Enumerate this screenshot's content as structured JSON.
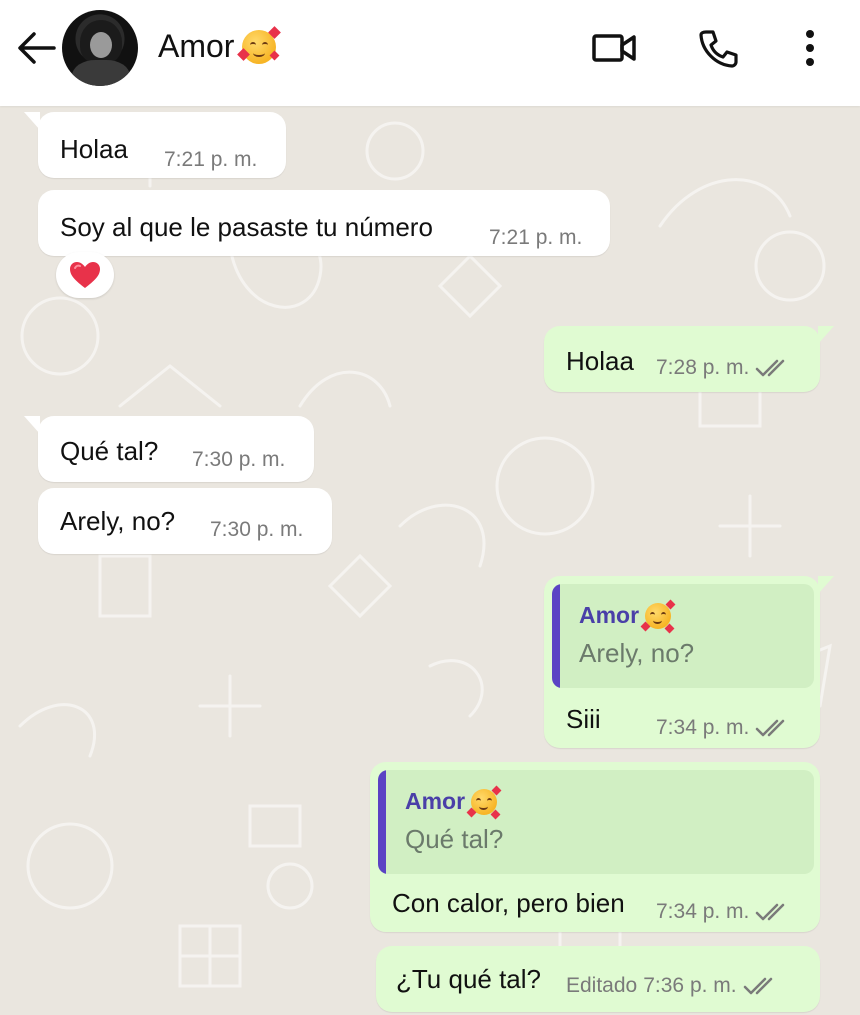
{
  "header": {
    "contact_name": "Amor",
    "contact_emoji": "smiling-face-with-hearts",
    "icons": [
      "arrow-left-icon",
      "video-call-icon",
      "phone-icon",
      "more-vert-icon"
    ]
  },
  "colors": {
    "incoming_bubble": "#ffffff",
    "outgoing_bubble": "#e0fbd2",
    "quote_bar": "#5b43c4",
    "quote_author": "#4a3fa8",
    "reaction_heart": "#e8324a"
  },
  "messages": [
    {
      "direction": "in",
      "text": "Holaa",
      "time": "7:21 p. m."
    },
    {
      "direction": "in",
      "text": "Soy al que le pasaste tu número",
      "time": "7:21 p. m.",
      "reaction": "heart"
    },
    {
      "direction": "out",
      "text": "Holaa",
      "time": "7:28 p. m.",
      "status": "read"
    },
    {
      "direction": "in",
      "text": "Qué tal?",
      "time": "7:30 p. m."
    },
    {
      "direction": "in",
      "text": "Arely, no?",
      "time": "7:30 p. m."
    },
    {
      "direction": "out",
      "quote_author": "Amor",
      "quote_text": "Arely, no?",
      "text": "Siii",
      "time": "7:34 p. m.",
      "status": "read"
    },
    {
      "direction": "out",
      "quote_author": "Amor",
      "quote_text": "Qué tal?",
      "text": "Con calor, pero bien",
      "time": "7:34 p. m.",
      "status": "read"
    },
    {
      "direction": "out",
      "text": "¿Tu qué tal?",
      "edited_label": "Editado",
      "time": "7:36 p. m.",
      "status": "read"
    }
  ]
}
